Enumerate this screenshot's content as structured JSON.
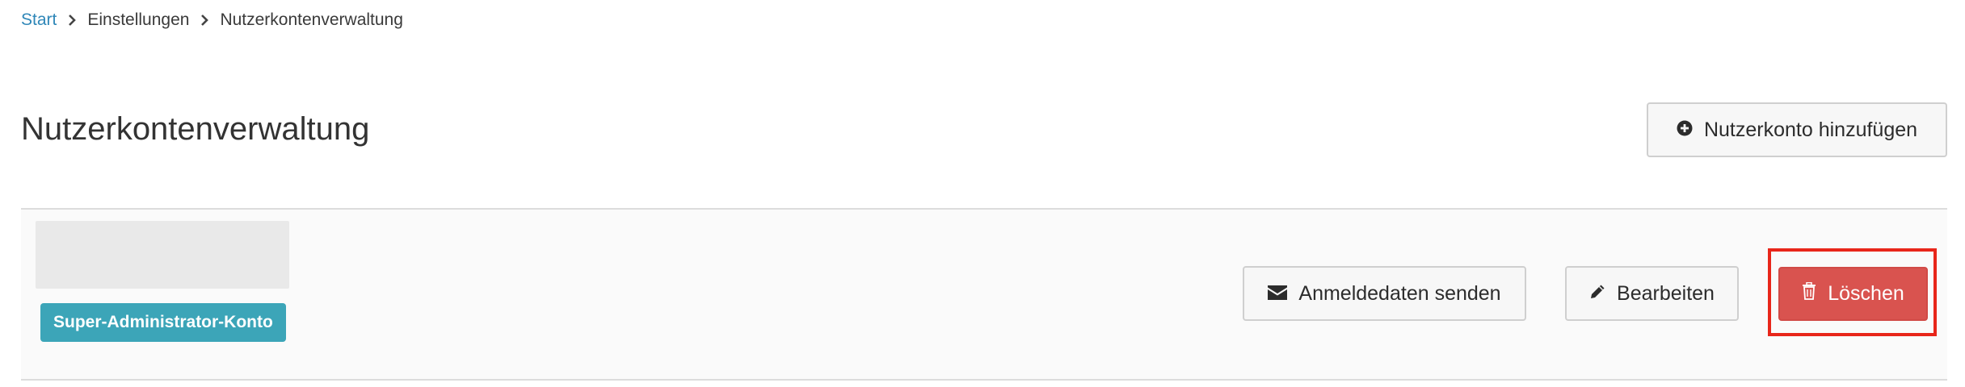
{
  "breadcrumb": {
    "items": [
      "Start",
      "Einstellungen",
      "Nutzerkontenverwaltung"
    ]
  },
  "page": {
    "title": "Nutzerkontenverwaltung"
  },
  "toolbar": {
    "add_label": "Nutzerkonto hinzufügen",
    "add_icon": "plus-circle-icon"
  },
  "account": {
    "badge": "Super-Administrator-Konto",
    "actions": {
      "send_label": "Anmeldedaten senden",
      "send_icon": "envelope-icon",
      "edit_label": "Bearbeiten",
      "edit_icon": "pencil-icon",
      "delete_label": "Löschen",
      "delete_icon": "trash-icon"
    }
  },
  "colors": {
    "link": "#2f87b8",
    "badge": "#3ca5b8",
    "danger": "#d9534f",
    "highlight": "#e8261a"
  }
}
